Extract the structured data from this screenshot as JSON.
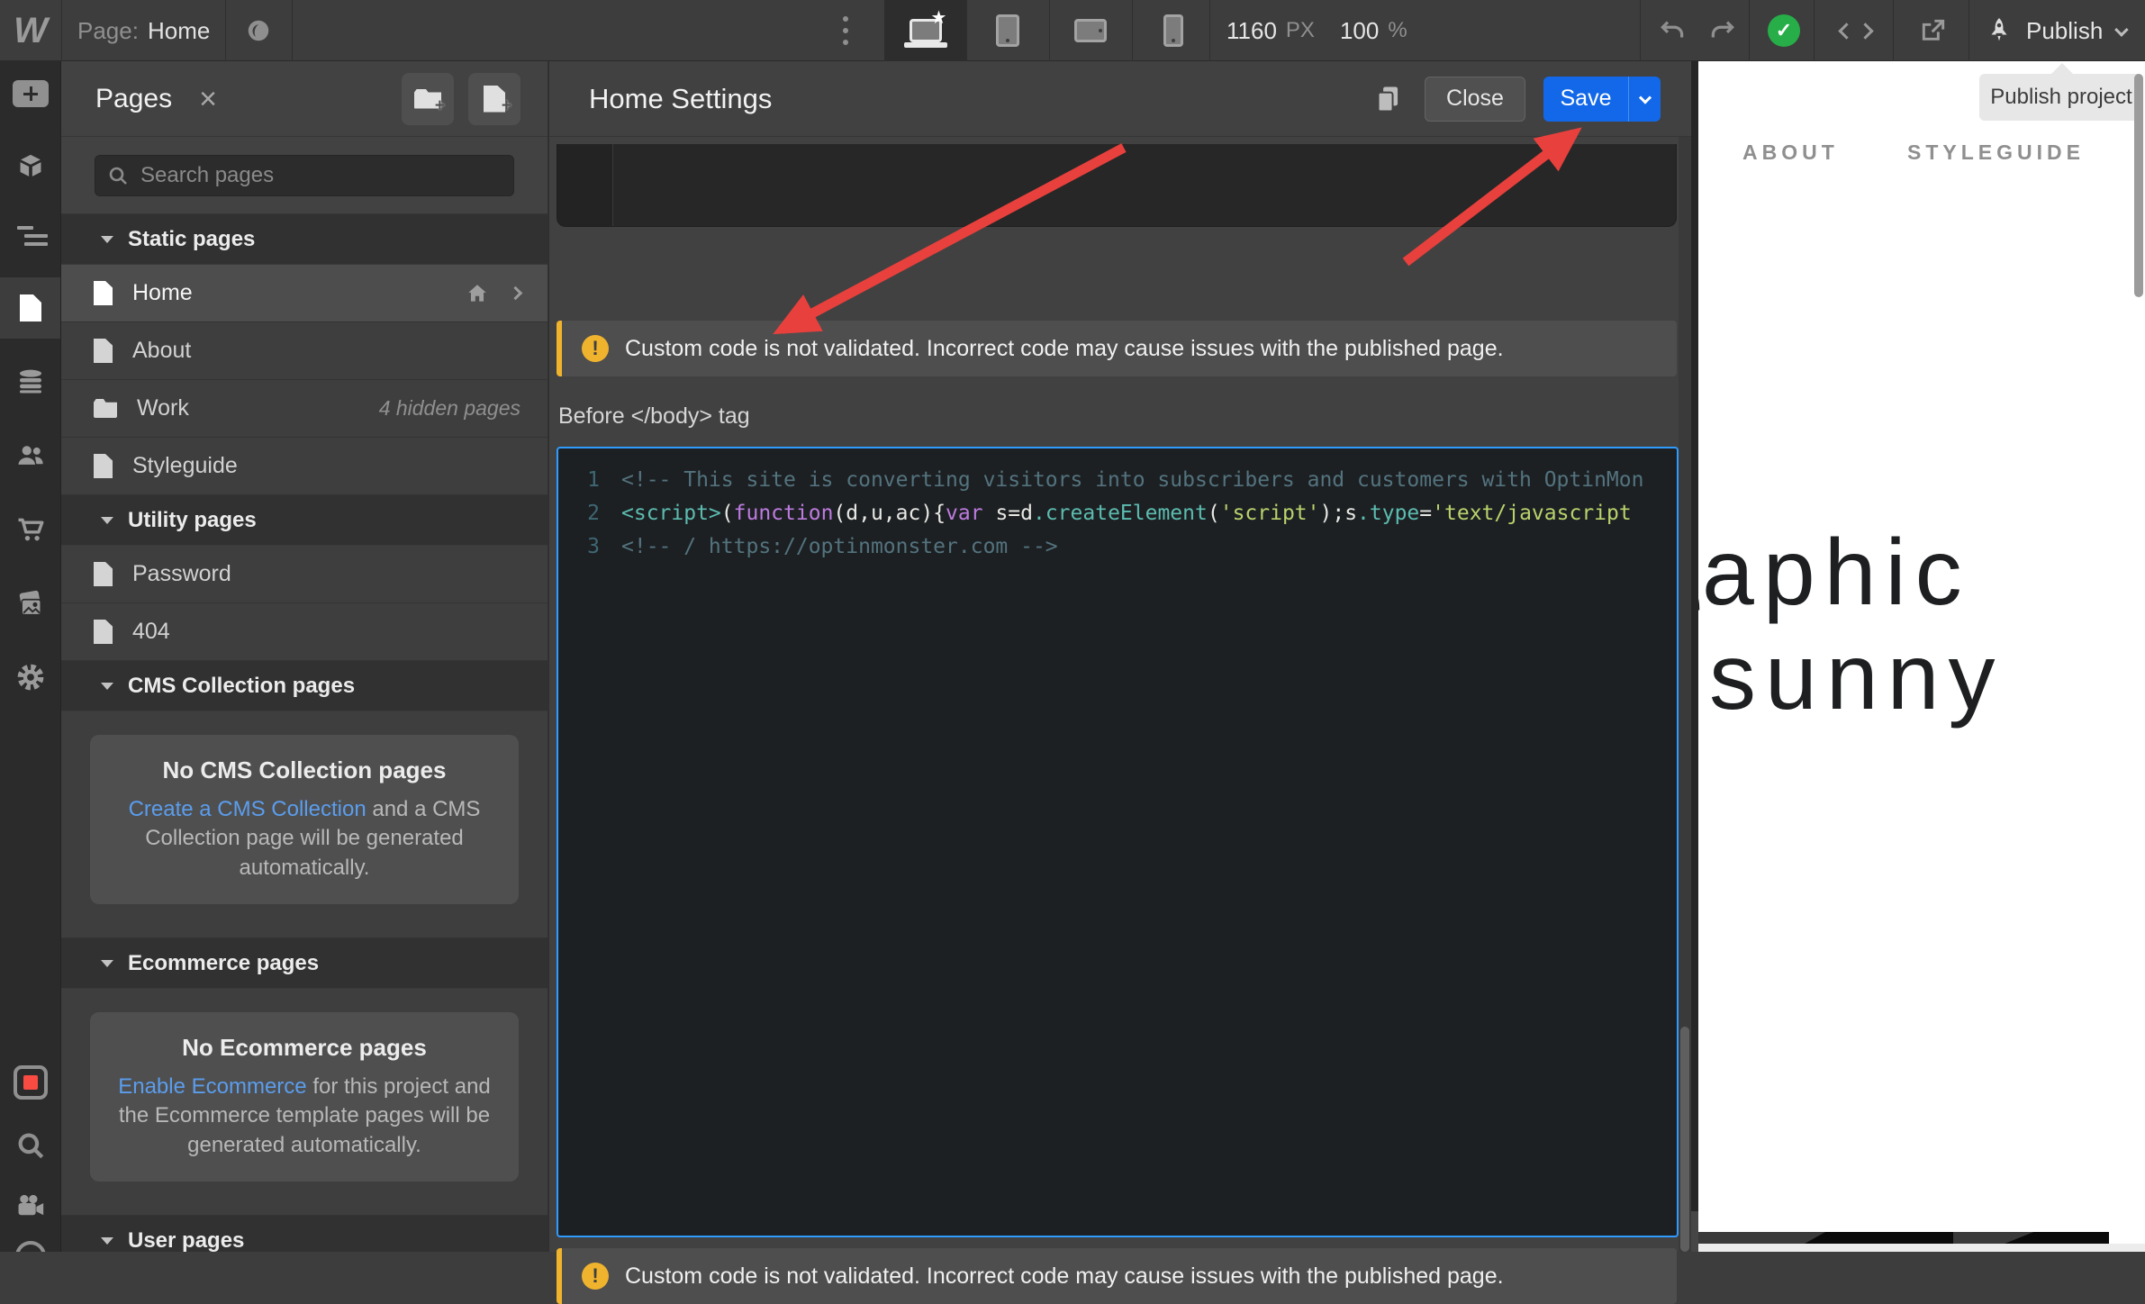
{
  "topbar": {
    "logo": "W",
    "page_label": "Page:",
    "page_name": "Home",
    "breakpoint_width": "1160",
    "breakpoint_unit": "PX",
    "zoom_value": "100",
    "zoom_unit": "%",
    "publish_label": "Publish",
    "publish_tooltip": "Publish project"
  },
  "pages_panel": {
    "title": "Pages",
    "search_placeholder": "Search pages",
    "sections": {
      "static": {
        "label": "Static pages"
      },
      "utility": {
        "label": "Utility pages"
      },
      "cms": {
        "label": "CMS Collection pages"
      },
      "ecommerce": {
        "label": "Ecommerce pages"
      },
      "user": {
        "label": "User pages"
      }
    },
    "items": {
      "home": {
        "label": "Home"
      },
      "about": {
        "label": "About"
      },
      "work": {
        "label": "Work",
        "meta": "4 hidden pages"
      },
      "styleguide": {
        "label": "Styleguide"
      },
      "password": {
        "label": "Password"
      },
      "notfound": {
        "label": "404"
      }
    },
    "cms_empty": {
      "title": "No CMS Collection pages",
      "link": "Create a CMS Collection",
      "rest": " and a CMS Collection page will be generated automatically."
    },
    "ecommerce_empty": {
      "title": "No Ecommerce pages",
      "link": "Enable Ecommerce",
      "rest": " for this project and the Ecommerce template pages will be generated automatically."
    }
  },
  "settings": {
    "title": "Home Settings",
    "close_label": "Close",
    "save_label": "Save",
    "warning_text": "Custom code is not validated. Incorrect code may cause issues with the published page.",
    "field_label": "Before </body> tag",
    "code_lines": [
      {
        "num": "1",
        "tokens": [
          {
            "t": "<!-- This site is converting visitors into subscribers and customers with OptinMon",
            "c": "comment"
          }
        ]
      },
      {
        "num": "2",
        "tokens": [
          {
            "t": "<script>",
            "c": "tag"
          },
          {
            "t": "(",
            "c": "plain"
          },
          {
            "t": "function",
            "c": "keyword"
          },
          {
            "t": "(d,u,ac){",
            "c": "plain"
          },
          {
            "t": "var",
            "c": "keyword"
          },
          {
            "t": " s=d",
            "c": "plain"
          },
          {
            "t": ".createElement",
            "c": "method"
          },
          {
            "t": "(",
            "c": "plain"
          },
          {
            "t": "'script'",
            "c": "string"
          },
          {
            "t": ");s",
            "c": "plain"
          },
          {
            "t": ".type",
            "c": "method"
          },
          {
            "t": "=",
            "c": "plain"
          },
          {
            "t": "'text/javascript",
            "c": "string"
          }
        ]
      },
      {
        "num": "3",
        "tokens": [
          {
            "t": "<!-- / https://optinmonster.com -->",
            "c": "comment"
          }
        ]
      }
    ]
  },
  "preview": {
    "nav_about": "ABOUT",
    "nav_styleguide": "STYLEGUIDE",
    "heading_fragment_1": "aphic",
    "heading_fragment_2": "sunny",
    "heading_partial_letter": "e"
  },
  "colors": {
    "accent_blue": "#1268e8",
    "focus_border": "#2f9bff",
    "warning_yellow": "#f0b32e",
    "arrow_red": "#e8403c",
    "link_blue": "#5b9ded",
    "success_green": "#27ae48"
  }
}
